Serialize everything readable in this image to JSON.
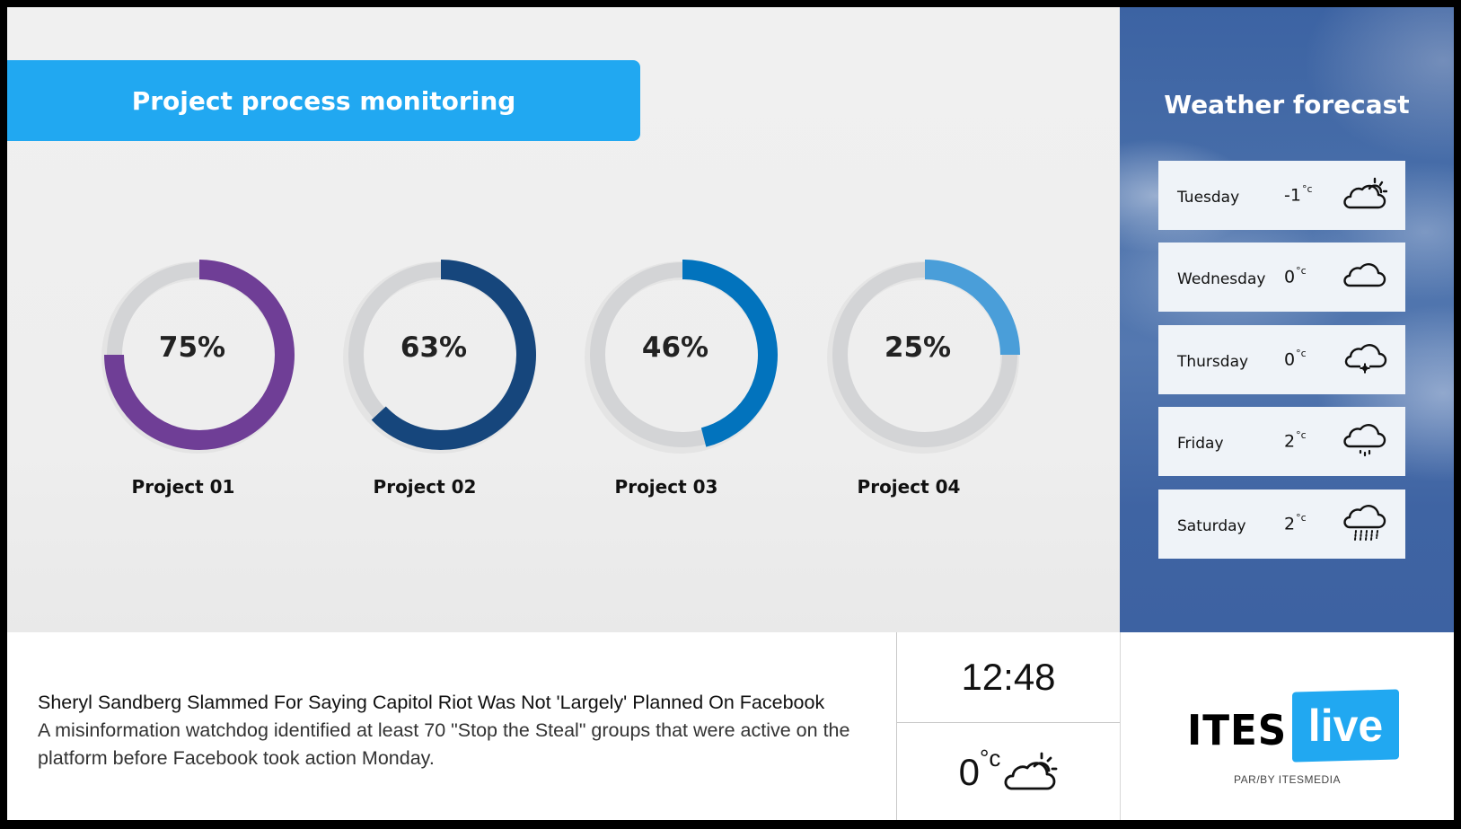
{
  "header": {
    "title": "Project process monitoring"
  },
  "projects": [
    {
      "label": "Project 01",
      "percent": 75,
      "percent_text": "75%",
      "color": "#6f3e96"
    },
    {
      "label": "Project 02",
      "percent": 63,
      "percent_text": "63%",
      "color": "#16467c"
    },
    {
      "label": "Project 03",
      "percent": 46,
      "percent_text": "46%",
      "color": "#0273bd"
    },
    {
      "label": "Project 04",
      "percent": 25,
      "percent_text": "25%",
      "color": "#4a9ed9"
    }
  ],
  "track_color": "#d3d4d6",
  "weather": {
    "title": "Weather forecast",
    "unit": "°c",
    "days": [
      {
        "day": "Tuesday",
        "temp": "-1",
        "icon": "partly-cloudy-icon"
      },
      {
        "day": "Wednesday",
        "temp": "0",
        "icon": "cloud-icon"
      },
      {
        "day": "Thursday",
        "temp": "0",
        "icon": "cloud-snow-icon"
      },
      {
        "day": "Friday",
        "temp": "2",
        "icon": "cloud-drizzle-icon"
      },
      {
        "day": "Saturday",
        "temp": "2",
        "icon": "cloud-rain-icon"
      }
    ]
  },
  "news": {
    "headline": "Sheryl Sandberg Slammed For Saying Capitol Riot Was Not 'Largely' Planned On Facebook",
    "body": "A misinformation watchdog identified at least 70 \"Stop the Steal\" groups that were active on the platform before Facebook took action Monday."
  },
  "clock": {
    "time": "12:48"
  },
  "current_weather": {
    "temp": "0",
    "unit": "°c",
    "icon": "partly-cloudy-icon"
  },
  "branding": {
    "brand": "ITES",
    "brand_highlight": "live",
    "tagline": "PAR/BY ITESMEDIA",
    "accent": "#21a8f1"
  }
}
